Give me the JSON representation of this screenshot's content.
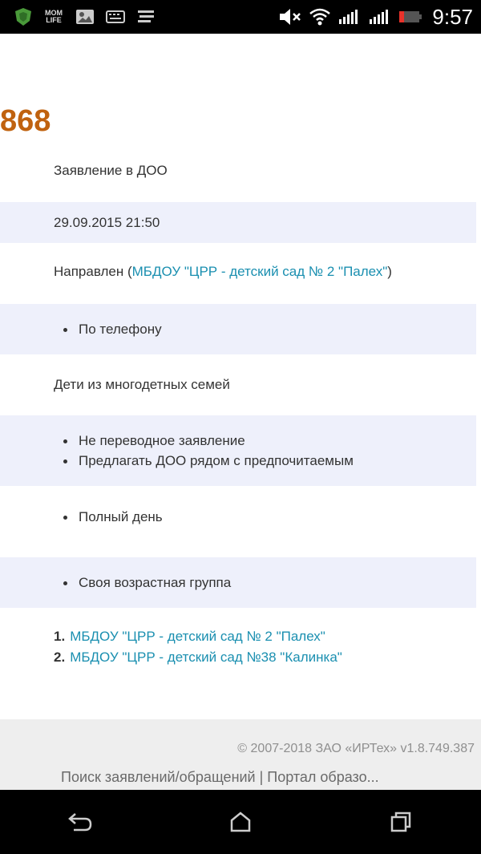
{
  "status_bar": {
    "time": "9:57",
    "left_icons": [
      "shield-app-icon",
      "mom-life-icon",
      "photo-app-icon",
      "keyboard-icon",
      "list-app-icon"
    ],
    "mom_life_line1": "MOM",
    "mom_life_line2": "LIFE",
    "right_icons": [
      "volume-muted-icon",
      "wifi-icon",
      "signal-1-icon",
      "signal-2-icon",
      "battery-icon"
    ],
    "battery_color": "#e8322a"
  },
  "application": {
    "number": "868",
    "type": "Заявление в ДОО",
    "datetime": "29.09.2015 21:50",
    "status_prefix": "Направлен (",
    "status_link": "МБДОУ \"ЦРР - детский сад № 2 \"Палех\"",
    "status_suffix": ")",
    "contact_methods": [
      "По телефону"
    ],
    "privilege": "Дети из многодетных семей",
    "options": [
      "Не переводное заявление",
      "Предлагать ДОО рядом с предпочитаемым"
    ],
    "schedule": [
      "Полный день"
    ],
    "group": [
      "Своя возрастная группа"
    ],
    "preferred_doo": [
      {
        "num": "1.",
        "name": "МБДОУ \"ЦРР - детский сад № 2 \"Палех\""
      },
      {
        "num": "2.",
        "name": "МБДОУ \"ЦРР - детский сад №38 \"Калинка\""
      }
    ]
  },
  "footer": {
    "copyright": "© 2007-2018 ЗАО «ИРТех» v1.8.749.387",
    "links": "Поиск заявлений/обращений | Портал образо..."
  },
  "nav_bar": {
    "buttons": [
      "back-icon",
      "home-icon",
      "recents-icon"
    ]
  },
  "colors": {
    "accent_number": "#c0620f",
    "link": "#1a8fb0",
    "row_shade": "#eef0fb",
    "footer_bg": "#eeeeee"
  }
}
